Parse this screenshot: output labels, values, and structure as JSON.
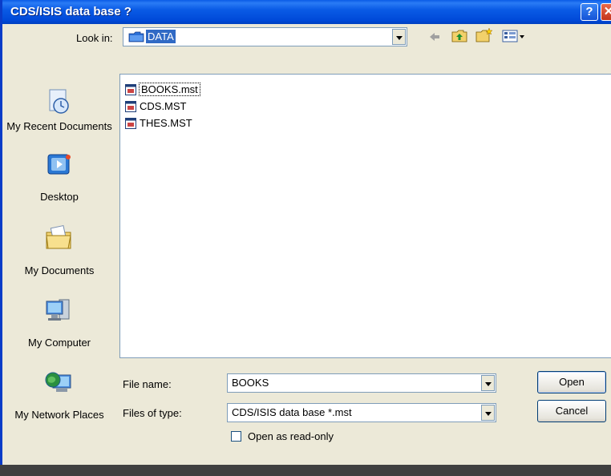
{
  "dialog": {
    "title": "CDS/ISIS data base ?",
    "help_glyph": "?",
    "close_glyph": "✕"
  },
  "look_in": {
    "label": "Look in:",
    "value": "DATA"
  },
  "toolbar": {
    "icons": [
      "back-arrow-icon",
      "up-one-level-icon",
      "new-folder-icon",
      "view-menu-icon"
    ]
  },
  "places": [
    {
      "label": "My Recent Documents",
      "icon": "recent-documents-icon"
    },
    {
      "label": "Desktop",
      "icon": "desktop-icon"
    },
    {
      "label": "My Documents",
      "icon": "my-documents-icon"
    },
    {
      "label": "My Computer",
      "icon": "my-computer-icon"
    },
    {
      "label": "My Network Places",
      "icon": "network-places-icon"
    }
  ],
  "files": [
    {
      "name": "BOOKS.mst",
      "selected": true
    },
    {
      "name": "CDS.MST",
      "selected": false
    },
    {
      "name": "THES.MST",
      "selected": false
    }
  ],
  "form": {
    "file_name_label": "File name:",
    "file_name_value": "BOOKS",
    "file_type_label": "Files of type:",
    "file_type_value": "CDS/ISIS data base *.mst",
    "readonly_label": "Open as read-only",
    "readonly_checked": false
  },
  "buttons": {
    "open": "Open",
    "cancel": "Cancel"
  }
}
